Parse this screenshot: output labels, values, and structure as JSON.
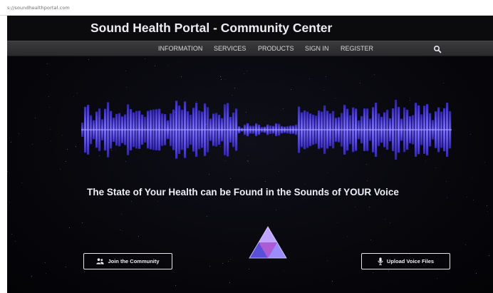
{
  "browser": {
    "url": "s://soundhealthportal.com"
  },
  "site": {
    "title": "Sound Health Portal - Community Center"
  },
  "nav": {
    "items": [
      "INFORMATION",
      "SERVICES",
      "PRODUCTS",
      "SIGN IN",
      "REGISTER"
    ],
    "search_icon": "search-icon"
  },
  "hero": {
    "tagline": "The State of Your Health can be Found in the Sounds of YOUR Voice",
    "waveform_color": "#5a4ee6",
    "logo": "triangle-logo"
  },
  "actions": {
    "join_label": "Join the Community",
    "join_icon": "users-icon",
    "upload_label": "Upload Voice Files",
    "upload_icon": "microphone-icon"
  },
  "colors": {
    "background": "#07070c",
    "navbar": "#333335",
    "accent": "#5a4ee6"
  }
}
